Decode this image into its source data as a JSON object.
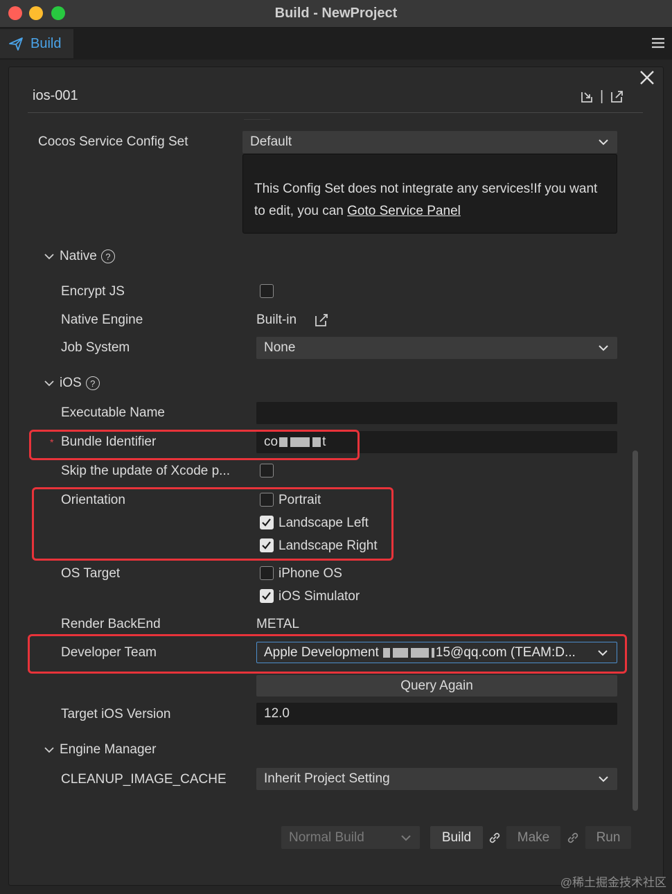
{
  "window": {
    "title": "Build - NewProject"
  },
  "tab": {
    "label": "Build"
  },
  "panel": {
    "title": "ios-001"
  },
  "service": {
    "label": "Cocos Service Config Set",
    "selected": "Default",
    "notice_text": "This Config Set does not integrate any services!If you want to edit, you can ",
    "notice_link": "Goto Service Panel"
  },
  "native": {
    "section_label": "Native",
    "encrypt_js_label": "Encrypt JS",
    "encrypt_js_checked": false,
    "native_engine_label": "Native Engine",
    "native_engine_value": "Built-in",
    "job_system_label": "Job System",
    "job_system_value": "None"
  },
  "ios": {
    "section_label": "iOS",
    "executable_name_label": "Executable Name",
    "executable_name_value": "",
    "bundle_identifier_label": "Bundle Identifier",
    "bundle_identifier_required_mark": "*",
    "bundle_identifier_value": "co",
    "bundle_identifier_value_tail": "t",
    "skip_xcode_label": "Skip the update of Xcode p...",
    "skip_xcode_checked": false,
    "orientation_label": "Orientation",
    "orientation_options": [
      {
        "label": "Portrait",
        "checked": false
      },
      {
        "label": "Landscape Left",
        "checked": true
      },
      {
        "label": "Landscape Right",
        "checked": true
      }
    ],
    "os_target_label": "OS Target",
    "os_target_options": [
      {
        "label": "iPhone OS",
        "checked": false
      },
      {
        "label": "iOS Simulator",
        "checked": true
      }
    ],
    "render_backend_label": "Render BackEnd",
    "render_backend_value": "METAL",
    "developer_team_label": "Developer Team",
    "developer_team_prefix": "Apple Development",
    "developer_team_suffix": "15@qq.com (TEAM:D...",
    "query_again_label": "Query Again",
    "target_ios_version_label": "Target iOS Version",
    "target_ios_version_value": "12.0"
  },
  "engine_manager": {
    "section_label": "Engine Manager",
    "cleanup_label": "CLEANUP_IMAGE_CACHE",
    "cleanup_value": "Inherit Project Setting"
  },
  "footer": {
    "build_mode": "Normal Build",
    "build_label": "Build",
    "make_label": "Make",
    "run_label": "Run"
  },
  "watermark": "@稀土掘金技术社区",
  "colors": {
    "accent": "#4aa3e8",
    "highlight_box": "#e8333a",
    "required": "#e0424a"
  }
}
